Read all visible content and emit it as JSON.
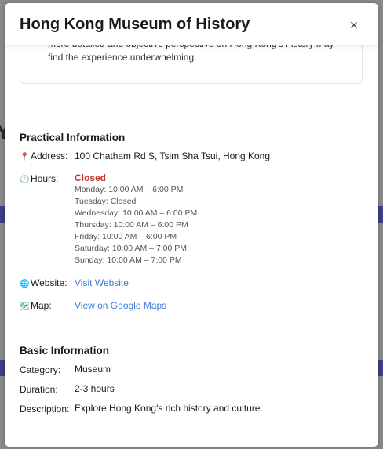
{
  "modal": {
    "title": "Hong Kong Museum of History",
    "close_label": "×"
  },
  "review": {
    "text": "more detailed and objective perspective on Hong Kong's history may find the experience underwhelming."
  },
  "practical": {
    "title": "Practical Information",
    "address_label": "Address:",
    "address_value": "100 Chatham Rd S, Tsim Sha Tsui, Hong Kong",
    "hours_label": "Hours:",
    "hours_status": "Closed",
    "hours": [
      "Monday: 10:00 AM – 6:00 PM",
      "Tuesday: Closed",
      "Wednesday: 10:00 AM – 6:00 PM",
      "Thursday: 10:00 AM – 6:00 PM",
      "Friday: 10:00 AM – 6:00 PM",
      "Saturday: 10:00 AM – 7:00 PM",
      "Sunday: 10:00 AM – 7:00 PM"
    ],
    "website_label": "Website:",
    "website_link": "Visit Website",
    "map_label": "Map:",
    "map_link": "View on Google Maps"
  },
  "basic": {
    "title": "Basic Information",
    "category_label": "Category:",
    "category_value": "Museum",
    "duration_label": "Duration:",
    "duration_value": "2-3 hours",
    "description_label": "Description:",
    "description_value": "Explore Hong Kong's rich history and culture."
  },
  "icons": {
    "address": "pin-icon",
    "hours": "clock-icon",
    "website": "globe-icon",
    "map": "map-icon"
  },
  "colors": {
    "closed": "#c0392b",
    "link": "#3b7dd8",
    "background_band": "#3d3f87"
  }
}
